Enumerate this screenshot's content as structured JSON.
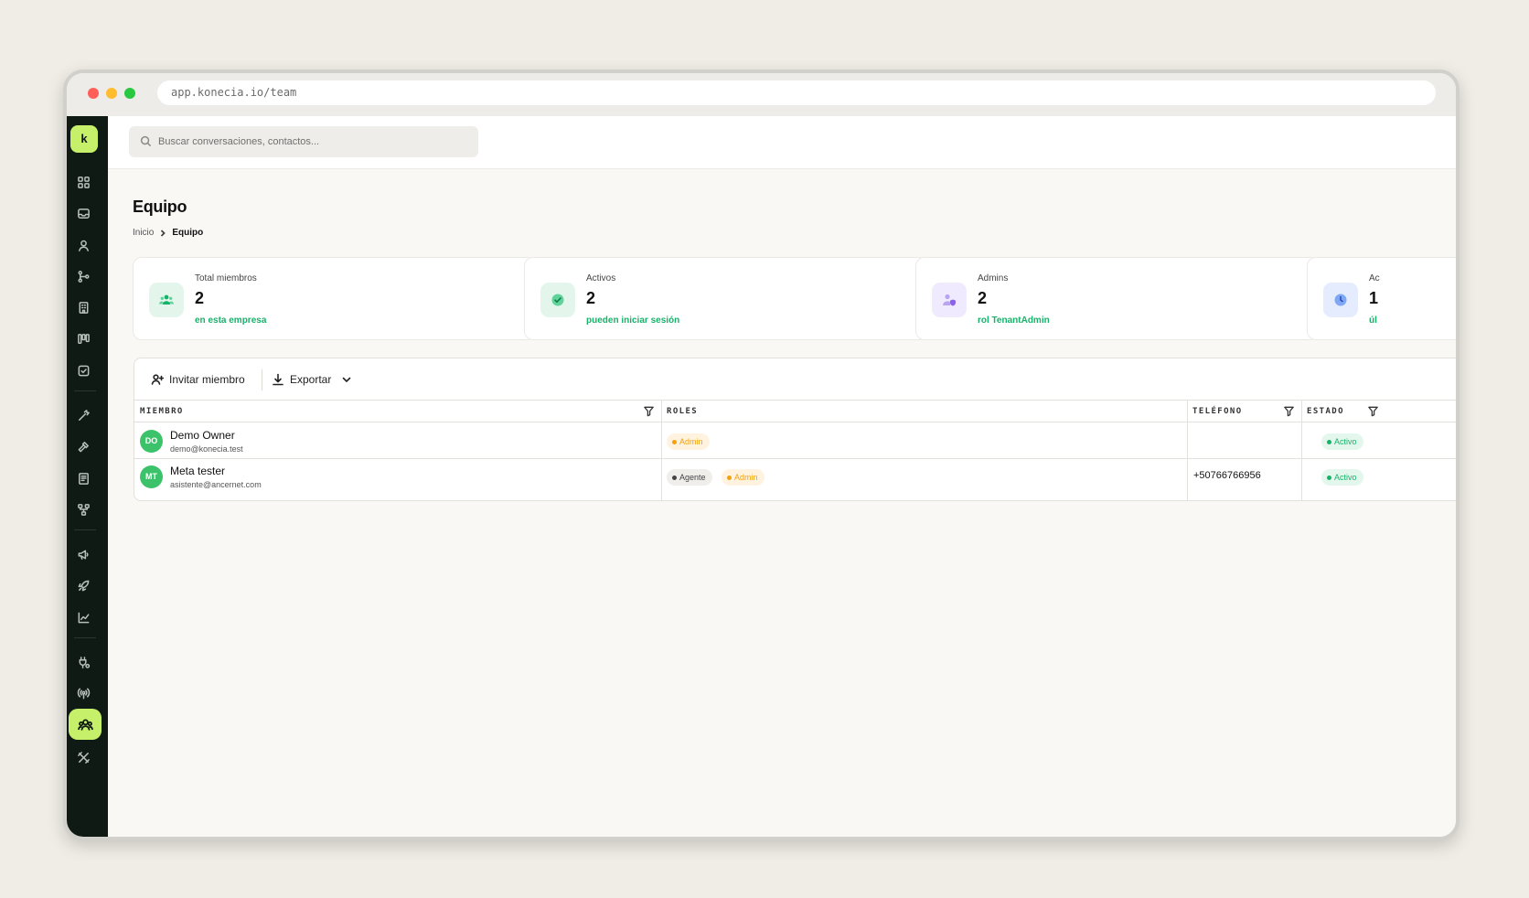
{
  "browser": {
    "url": "app.konecia.io/team"
  },
  "sidebar": {
    "logo_letter": "k"
  },
  "search": {
    "placeholder": "Buscar conversaciones, contactos..."
  },
  "page": {
    "title": "Equipo",
    "breadcrumb": {
      "home": "Inicio",
      "current": "Equipo"
    }
  },
  "stats": [
    {
      "label": "Total miembros",
      "value": "2",
      "sub": "en esta empresa",
      "icon": "users-icon",
      "color": "#17b26a"
    },
    {
      "label": "Activos",
      "value": "2",
      "sub": "pueden iniciar sesión",
      "icon": "check-circle-icon",
      "color": "#17b26a"
    },
    {
      "label": "Admins",
      "value": "2",
      "sub": "rol TenantAdmin",
      "icon": "user-shield-icon",
      "color": "#9b7be8"
    },
    {
      "label": "Ac",
      "value": "1",
      "sub": "úl",
      "icon": "clock-icon",
      "color": "#5b8def"
    }
  ],
  "toolbar": {
    "invite_label": "Invitar miembro",
    "export_label": "Exportar"
  },
  "table": {
    "columns": {
      "member": "MIEMBRO",
      "roles": "ROLES",
      "phone": "TELÉFONO",
      "status": "ESTADO"
    },
    "rows": [
      {
        "initials": "DO",
        "name": "Demo Owner",
        "email": "demo@konecia.test",
        "roles": [
          "Admin"
        ],
        "phone": "",
        "status": "Activo"
      },
      {
        "initials": "MT",
        "name": "Meta tester",
        "email": "asistente@ancernet.com",
        "roles": [
          "Agente",
          "Admin"
        ],
        "phone": "+50766766956",
        "status": "Activo"
      }
    ]
  }
}
